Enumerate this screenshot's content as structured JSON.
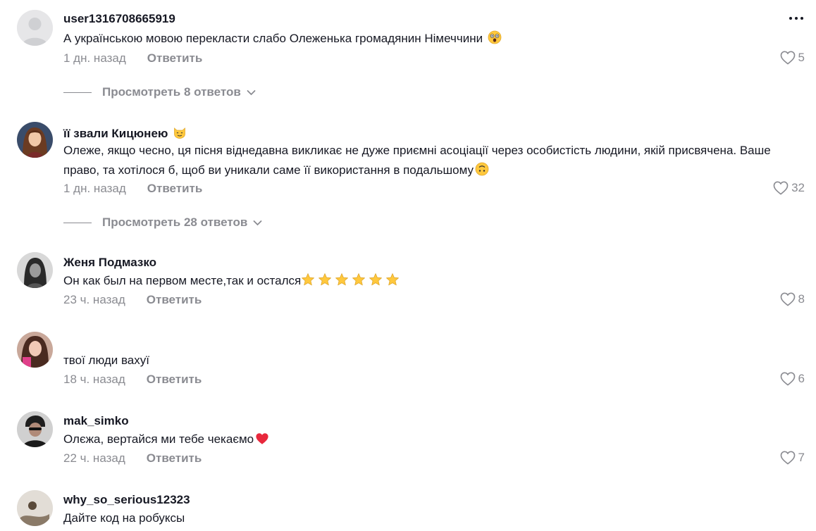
{
  "comments": [
    {
      "username": "user1316708665919",
      "text": "А українською мовою перекласти слабо Олеженька громадянин Німеччини",
      "time": "1 дн. назад",
      "reply_label": "Ответить",
      "likes": "5",
      "view_replies": "Просмотреть 8 ответов",
      "emoji": "astonished-face-emoji"
    },
    {
      "username": "її звали Кицюнею",
      "text_line1": "Олеже, якщо чесно, ця пісня віднедавна викликає не дуже приємні асоціації через особистість людини, якій присвячена. Ваше",
      "text_line2": "право, та хотілося б, щоб ви уникали саме її використання в подальшому",
      "time": "1 дн. назад",
      "reply_label": "Ответить",
      "likes": "32",
      "view_replies": "Просмотреть 28 ответов",
      "emoji": "upside-down-face-emoji"
    },
    {
      "username": "Женя Подмазко",
      "text": "Он как был на первом месте,так и остался",
      "time": "23 ч. назад",
      "reply_label": "Ответить",
      "likes": "8",
      "emoji": "star-emoji"
    },
    {
      "username": "",
      "text": "твої люди вахуї",
      "time": "18 ч. назад",
      "reply_label": "Ответить",
      "likes": "6"
    },
    {
      "username": "mak_simko",
      "text": "Олєжа, вертайся ми тебе чекаємо",
      "time": "22 ч. назад",
      "reply_label": "Ответить",
      "likes": "7",
      "emoji": "red-heart-emoji"
    },
    {
      "username": "why_so_serious12323",
      "text": "Дайте код на робуксы"
    }
  ],
  "colors": {
    "text": "#161823",
    "muted": "#8a8b91",
    "heart_red": "#e8283c",
    "star_yellow": "#ffc83d"
  }
}
